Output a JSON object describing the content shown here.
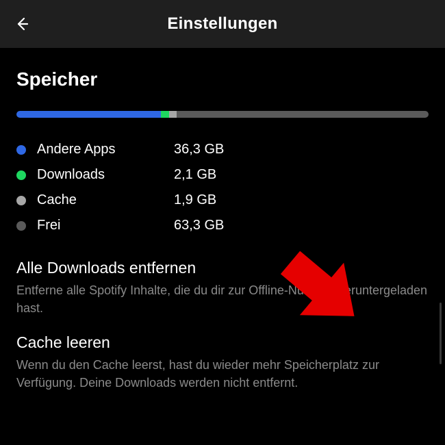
{
  "header": {
    "title": "Einstellungen"
  },
  "section": {
    "title": "Speicher"
  },
  "colors": {
    "other_apps": "#2f68e4",
    "downloads": "#1ed760",
    "cache": "#a7a7a7",
    "free": "#5a5a5a"
  },
  "storage": {
    "bar": {
      "other_apps_pct": 35.0,
      "downloads_pct": 2.0,
      "cache_pct": 1.8,
      "free_pct": 61.2
    },
    "legend": [
      {
        "key": "other_apps",
        "label": "Andere Apps",
        "value": "36,3 GB"
      },
      {
        "key": "downloads",
        "label": "Downloads",
        "value": "2,1 GB"
      },
      {
        "key": "cache",
        "label": "Cache",
        "value": "1,9 GB"
      },
      {
        "key": "free",
        "label": "Frei",
        "value": "63,3 GB"
      }
    ]
  },
  "options": {
    "remove_downloads": {
      "title": "Alle Downloads entfernen",
      "description": "Entferne alle Spotify Inhalte, die du dir zur Offline-Nutzung heruntergeladen hast."
    },
    "clear_cache": {
      "title": "Cache leeren",
      "description": "Wenn du den Cache leerst, hast du wieder mehr Speicherplatz zur Verfügung. Deine Downloads werden nicht entfernt."
    }
  },
  "annotation": {
    "arrow_color": "#e50000"
  }
}
